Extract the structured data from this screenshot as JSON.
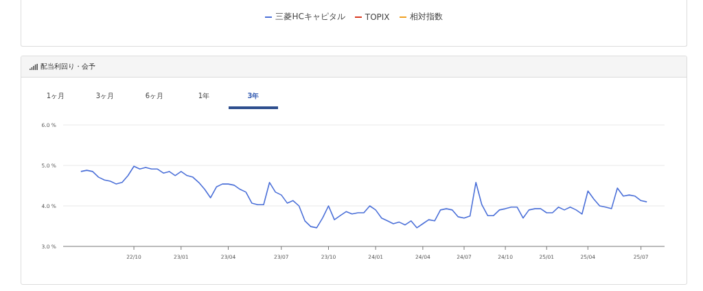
{
  "top_card": {
    "legend": [
      {
        "label": "三菱HCキャピタル",
        "color": "#4a6fd8"
      },
      {
        "label": "TOPIX",
        "color": "#d9381e"
      },
      {
        "label": "相対指数",
        "color": "#f0a020"
      }
    ]
  },
  "yield_card": {
    "title": "配当利回り・会予",
    "tabs": [
      {
        "label": "1ヶ月",
        "selected": false
      },
      {
        "label": "3ヶ月",
        "selected": false
      },
      {
        "label": "6ヶ月",
        "selected": false
      },
      {
        "label": "1年",
        "selected": false
      },
      {
        "label": "3年",
        "selected": true
      }
    ],
    "chart_data": {
      "type": "line",
      "categories": [
        null,
        null,
        null,
        null,
        null,
        null,
        null,
        null,
        null,
        "22/10",
        null,
        null,
        null,
        null,
        null,
        null,
        null,
        "23/01",
        null,
        null,
        null,
        null,
        null,
        null,
        null,
        "23/04",
        null,
        null,
        null,
        null,
        null,
        null,
        null,
        null,
        "23/07",
        null,
        null,
        null,
        null,
        null,
        null,
        null,
        "23/10",
        null,
        null,
        null,
        null,
        null,
        null,
        null,
        "24/01",
        null,
        null,
        null,
        null,
        null,
        null,
        null,
        "24/04",
        null,
        null,
        null,
        null,
        null,
        null,
        "24/07",
        null,
        null,
        null,
        null,
        null,
        null,
        "24/10",
        null,
        null,
        null,
        null,
        null,
        null,
        "25/01",
        null,
        null,
        null,
        null,
        null,
        null,
        "25/04",
        null,
        null,
        null,
        null,
        null,
        null,
        null,
        null,
        "25/07",
        null
      ],
      "series": [
        {
          "color": "#4a6fd8",
          "values": [
            4.85,
            4.88,
            4.85,
            4.71,
            4.64,
            4.61,
            4.54,
            4.58,
            4.75,
            4.98,
            4.91,
            4.95,
            4.91,
            4.91,
            4.81,
            4.85,
            4.75,
            4.85,
            4.75,
            4.71,
            4.58,
            4.41,
            4.2,
            4.47,
            4.54,
            4.54,
            4.51,
            4.41,
            4.34,
            4.07,
            4.03,
            4.03,
            4.58,
            4.34,
            4.27,
            4.07,
            4.13,
            4.0,
            3.63,
            3.49,
            3.46,
            3.7,
            4.0,
            3.66,
            3.76,
            3.86,
            3.8,
            3.83,
            3.83,
            4.0,
            3.9,
            3.7,
            3.63,
            3.56,
            3.6,
            3.53,
            3.63,
            3.46,
            3.56,
            3.66,
            3.63,
            3.9,
            3.93,
            3.9,
            3.73,
            3.7,
            3.75,
            4.58,
            4.03,
            3.76,
            3.76,
            3.9,
            3.93,
            3.97,
            3.97,
            3.7,
            3.9,
            3.93,
            3.93,
            3.83,
            3.83,
            3.97,
            3.9,
            3.97,
            3.9,
            3.8,
            4.37,
            4.17,
            4.0,
            3.97,
            3.93,
            4.44,
            4.24,
            4.27,
            4.24,
            4.13,
            4.1
          ]
        }
      ],
      "ylim": [
        3,
        6
      ],
      "yticks": [
        {
          "value": 3,
          "label": "3.0 %"
        },
        {
          "value": 4,
          "label": "4.0 %"
        },
        {
          "value": 5,
          "label": "5.0 %"
        },
        {
          "value": 6,
          "label": "6.0 %"
        }
      ]
    }
  }
}
